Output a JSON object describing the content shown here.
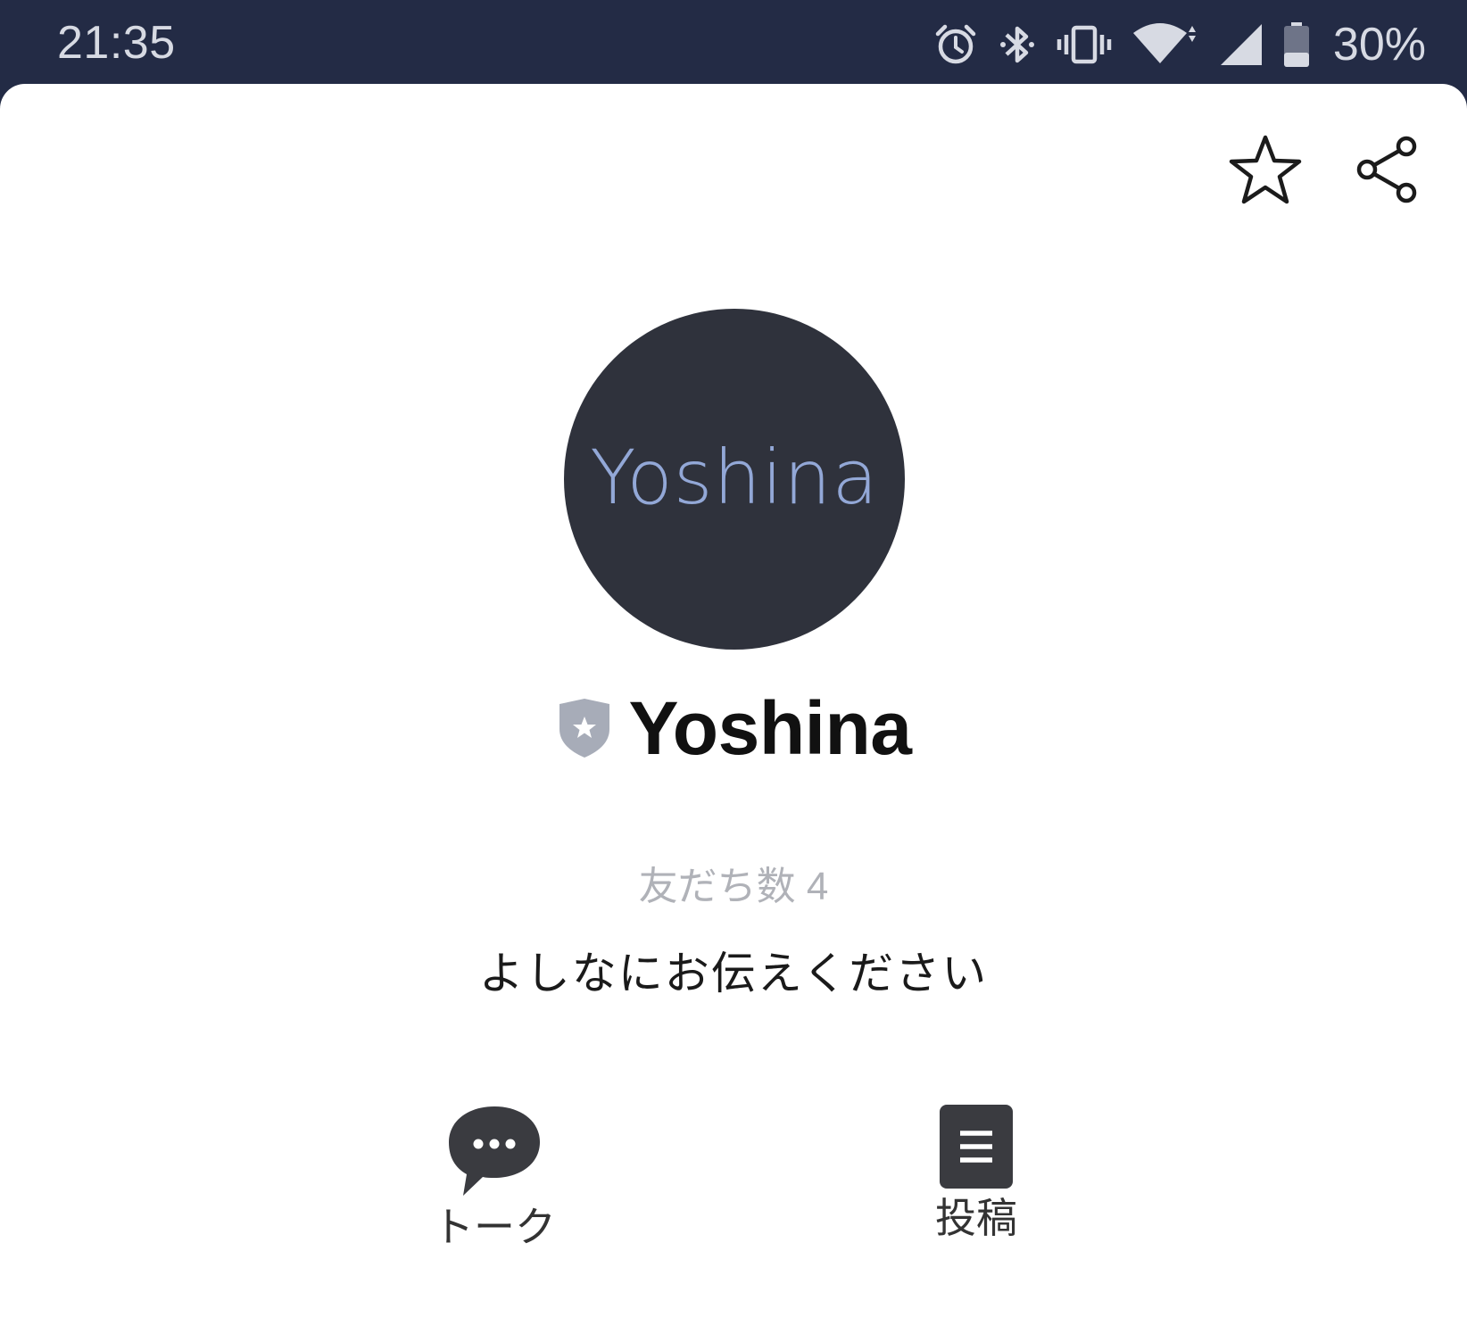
{
  "status_bar": {
    "time": "21:35",
    "battery_percent": "30%",
    "icons": [
      "alarm-icon",
      "bluetooth-icon",
      "vibrate-icon",
      "wifi-icon",
      "signal-icon",
      "battery-icon"
    ]
  },
  "header_actions": {
    "favorite_icon": "star-outline-icon",
    "share_icon": "share-icon"
  },
  "profile": {
    "avatar_text": "Yoshina",
    "badge_icon": "verified-shield-icon",
    "name": "Yoshina",
    "friends_count": "友だち数 4",
    "status_message": "よしなにお伝えください"
  },
  "actions": [
    {
      "label": "トーク",
      "icon": "chat-bubble-icon"
    },
    {
      "label": "投稿",
      "icon": "post-icon"
    }
  ],
  "colors": {
    "status_bar_bg": "#232b45",
    "avatar_bg": "#2f323c",
    "avatar_text": "#93a8d7",
    "icon_dark": "#3a3b40",
    "badge": "#a7acb8"
  }
}
